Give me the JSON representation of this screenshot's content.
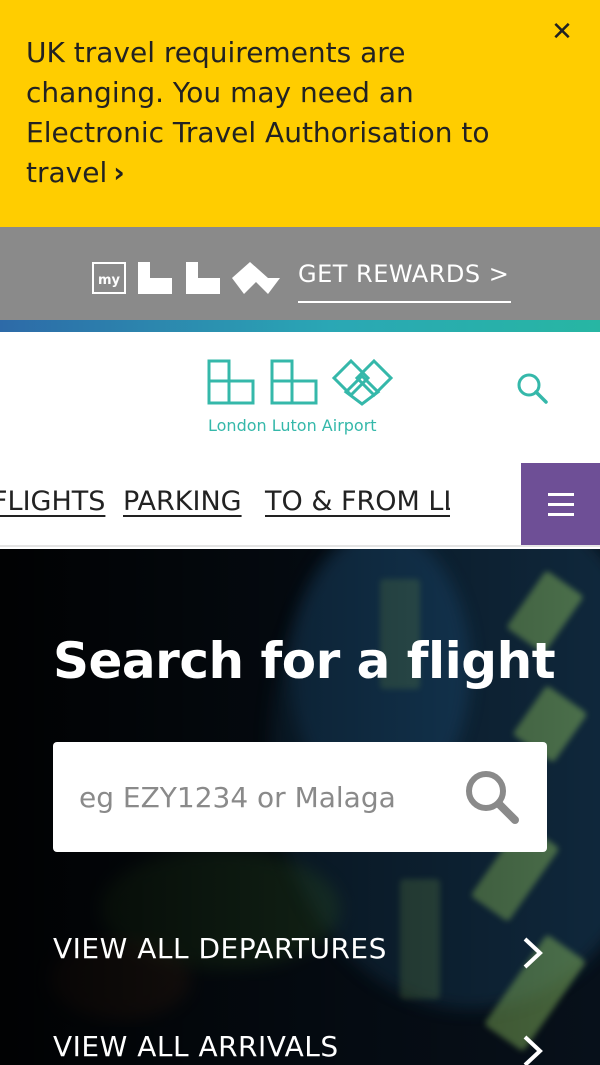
{
  "alert": {
    "text": "UK travel requirements are changing. You may need an Electronic Travel Authorisation to travel",
    "chevron": "›",
    "close": "✕"
  },
  "rewards": {
    "logo_label": "my",
    "link": "GET REWARDS >"
  },
  "header": {
    "logo_text": "London Luton Airport"
  },
  "nav": {
    "items": [
      "FLIGHTS",
      "PARKING",
      "TO & FROM LLA"
    ]
  },
  "hero": {
    "title": "Search for a flight",
    "search_placeholder": "eg EZY1234 or Malaga",
    "links": [
      "VIEW ALL DEPARTURES",
      "VIEW ALL ARRIVALS"
    ]
  },
  "colors": {
    "alert_bg": "#ffcd00",
    "rewards_bg": "#8a8a8a",
    "brand_teal": "#35b8aa",
    "menu_purple": "#6e4f96"
  }
}
